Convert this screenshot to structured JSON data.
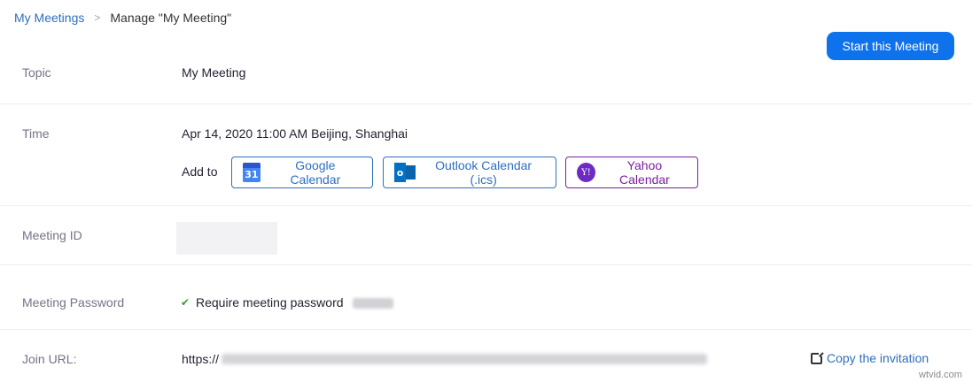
{
  "breadcrumb": {
    "parent": "My Meetings",
    "separator": ">",
    "current": "Manage \"My Meeting\""
  },
  "actions": {
    "start_label": "Start this Meeting"
  },
  "fields": {
    "topic": {
      "label": "Topic",
      "value": "My Meeting"
    },
    "time": {
      "label": "Time",
      "value": "Apr 14, 2020 11:00 AM Beijing, Shanghai",
      "add_to_label": "Add to",
      "calendars": {
        "google": {
          "label": "Google Calendar",
          "icon": "google-calendar-icon",
          "icon_text": "31",
          "color": "#2d6fbf"
        },
        "outlook": {
          "label": "Outlook Calendar (.ics)",
          "icon": "outlook-icon",
          "icon_text": "o",
          "color": "#2d6fbf"
        },
        "yahoo": {
          "label": "Yahoo Calendar",
          "icon": "yahoo-icon",
          "icon_text": "Y!",
          "color": "#7b1fa2"
        }
      }
    },
    "meeting_id": {
      "label": "Meeting ID"
    },
    "password": {
      "label": "Meeting Password",
      "require_text": "Require meeting password",
      "check_glyph": "✔"
    },
    "join_url": {
      "label": "Join URL:",
      "prefix": "https://",
      "copy_label": "Copy the invitation"
    }
  },
  "watermark": "wtvid.com",
  "colors": {
    "primary": "#0e72ed",
    "link": "#2d6fbf",
    "yahoo": "#7b1fa2",
    "check": "#33a02c"
  }
}
